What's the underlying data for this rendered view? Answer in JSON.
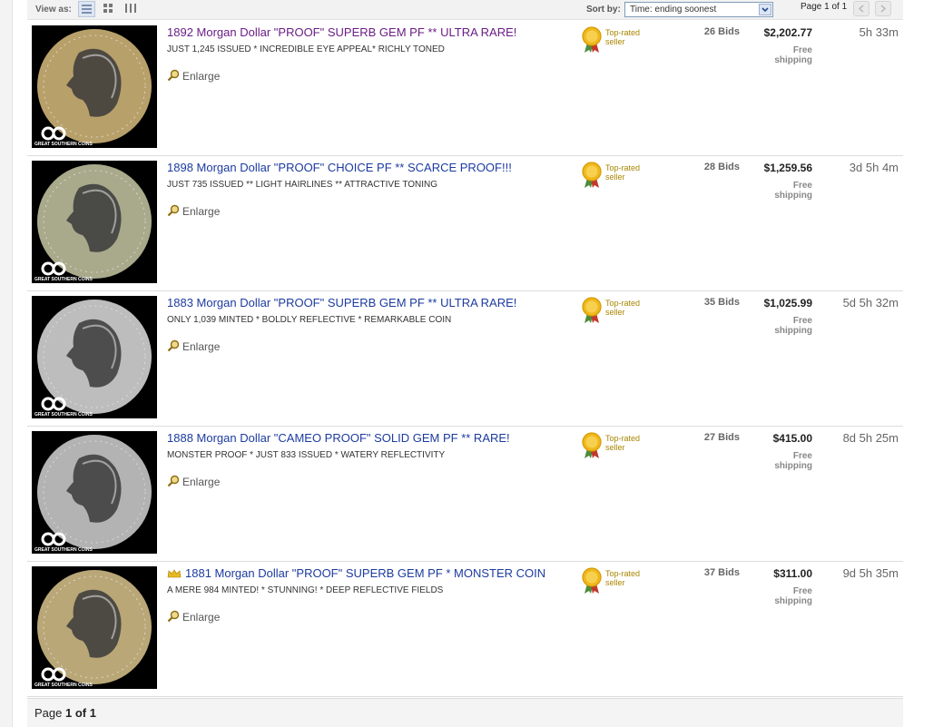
{
  "toolbar": {
    "view_as_label": "View as:",
    "sort_label": "Sort by:",
    "sort_value": "Time: ending soonest",
    "page_label": "Page 1 of 1"
  },
  "listings": [
    {
      "title": "1892 Morgan Dollar \"PROOF\" SUPERB GEM PF ** ULTRA RARE!",
      "subtitle": "JUST 1,245 ISSUED * INCREDIBLE EYE APPEAL* RICHLY TONED",
      "enlarge": "Enlarge",
      "seller_badge": "Top-rated seller",
      "bids": "26 Bids",
      "price": "$2,202.77",
      "shipping": "Free shipping",
      "time_left": "5h 33m",
      "visited": true,
      "featured": false,
      "coin_color": "#b8a06a"
    },
    {
      "title": "1898 Morgan Dollar \"PROOF\" CHOICE PF ** SCARCE PROOF!!!",
      "subtitle": "JUST 735 ISSUED ** LIGHT HAIRLINES ** ATTRACTIVE TONING",
      "enlarge": "Enlarge",
      "seller_badge": "Top-rated seller",
      "bids": "28 Bids",
      "price": "$1,259.56",
      "shipping": "Free shipping",
      "time_left": "3d 5h 4m",
      "visited": false,
      "featured": false,
      "coin_color": "#a9a98c"
    },
    {
      "title": "1883 Morgan Dollar \"PROOF\" SUPERB GEM PF ** ULTRA RARE!",
      "subtitle": "ONLY 1,039 MINTED * BOLDLY REFLECTIVE * REMARKABLE COIN",
      "enlarge": "Enlarge",
      "seller_badge": "Top-rated seller",
      "bids": "35 Bids",
      "price": "$1,025.99",
      "shipping": "Free shipping",
      "time_left": "5d 5h 32m",
      "visited": false,
      "featured": false,
      "coin_color": "#bdbdbd"
    },
    {
      "title": "1888 Morgan Dollar \"CAMEO PROOF\" SOLID GEM PF ** RARE!",
      "subtitle": "MONSTER PROOF * JUST 833 ISSUED * WATERY REFLECTIVITY",
      "enlarge": "Enlarge",
      "seller_badge": "Top-rated seller",
      "bids": "27 Bids",
      "price": "$415.00",
      "shipping": "Free shipping",
      "time_left": "8d 5h 25m",
      "visited": false,
      "featured": false,
      "coin_color": "#b3b3b3"
    },
    {
      "title": "1881 Morgan Dollar \"PROOF\" SUPERB GEM PF * MONSTER COIN",
      "subtitle": "A MERE 984 MINTED! * STUNNING! * DEEP REFLECTIVE FIELDS",
      "enlarge": "Enlarge",
      "seller_badge": "Top-rated seller",
      "bids": "37 Bids",
      "price": "$311.00",
      "shipping": "Free shipping",
      "time_left": "9d 5h 35m",
      "visited": false,
      "featured": true,
      "coin_color": "#b9a777"
    }
  ],
  "coin_watermark": "GREAT SOUTHERN COINS",
  "footer": {
    "page_prefix": "Page",
    "page_current": "1",
    "page_of": "of",
    "page_total": "1"
  }
}
